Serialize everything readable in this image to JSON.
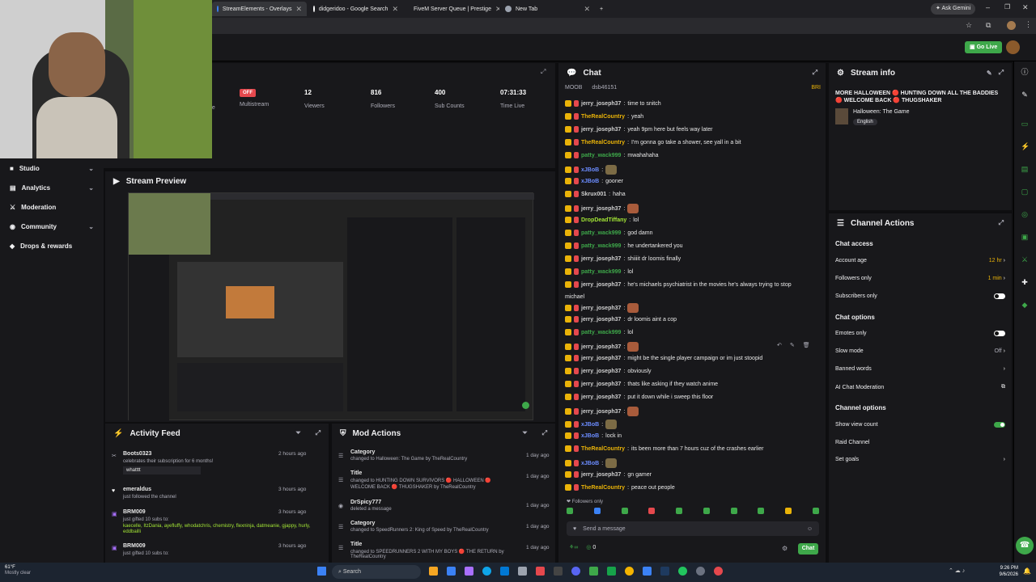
{
  "browser": {
    "tabs": [
      {
        "label": "StreamElements - Overlays",
        "color": "#3b82f6"
      },
      {
        "label": "didgeridoo - Google Search",
        "color": "#ffffff"
      },
      {
        "label": "FiveM Server Queue | Prestige",
        "color": "#ef4444"
      },
      {
        "label": "New Tab",
        "color": "#9ca3af"
      }
    ],
    "ask_gemini": "Ask Gemini"
  },
  "topnav": {
    "go_live": "Go Live"
  },
  "sidebar": {
    "items": [
      {
        "label": "Studio",
        "has_chevron": true
      },
      {
        "label": "Analytics",
        "has_chevron": true
      },
      {
        "label": "Moderation",
        "has_chevron": false
      },
      {
        "label": "Community",
        "has_chevron": true
      },
      {
        "label": "Drops & rewards",
        "has_chevron": false
      }
    ]
  },
  "stats": {
    "partial_label": "ne",
    "multistream_badge": "OFF",
    "multistream_label": "Multistream",
    "viewers_value": "12",
    "viewers_label": "Viewers",
    "followers_value": "816",
    "followers_label": "Followers",
    "subs_value": "400",
    "subs_label": "Sub Counts",
    "time_value": "07:31:33",
    "time_label": "Time Live"
  },
  "stream_preview": {
    "title": "Stream Preview"
  },
  "activity_feed": {
    "title": "Activity Feed",
    "items": [
      {
        "user": "Boots0323",
        "text": "celebrates their subscription for 6 months!",
        "time": "2 hours ago",
        "message": "whatttt"
      },
      {
        "user": "emeraldus",
        "text": "just followed the channel",
        "time": "3 hours ago"
      },
      {
        "user": "BRM009",
        "text": "just gifted 10 subs to:",
        "time": "3 hours ago",
        "list": "kaecelle, ItzDania, ayefluffy, whodatchris, chemistry, flexninja, datmeanie, gjappy, hurly, eddbailli"
      },
      {
        "user": "BRM009",
        "text": "just gifted 10 subs to:",
        "time": "3 hours ago"
      }
    ]
  },
  "mod_actions": {
    "title": "Mod Actions",
    "items": [
      {
        "type": "Category",
        "detail": "changed to Halloween: The Game by TheRealCountry",
        "time": "1 day ago"
      },
      {
        "type": "Title",
        "detail": "changed to HUNTING DOWN SURVIVORS 🔴 HALLOWEEN 🔴 WELCOME BACK 🔴 THUGSHAKER by TheRealCountry",
        "time": "1 day ago"
      },
      {
        "type": "DrSpicy777",
        "detail": "deleted a message",
        "time": "1 day ago"
      },
      {
        "type": "Category",
        "detail": "changed to SpeedRunners 2: King of Speed by TheRealCountry",
        "time": "1 day ago"
      },
      {
        "type": "Title",
        "detail": "changed to SPEEDRUNNERS 2 WITH MY BOYS 🔴 THE RETURN by TheRealCountry",
        "time": "1 day ago"
      }
    ]
  },
  "chat": {
    "title": "Chat",
    "top_users": [
      "MOOB",
      "dsb46151"
    ],
    "top_badge": "BRI",
    "lines": [
      {
        "user": "jerry_joseph37",
        "cls": "u-j",
        "msg": "time to snitch"
      },
      {
        "user": "TheRealCountry",
        "cls": "u-r",
        "msg": "yeah"
      },
      {
        "user": "jerry_joseph37",
        "cls": "u-j",
        "msg": "yeah 9pm here but feels way later"
      },
      {
        "user": "TheRealCountry",
        "cls": "u-r",
        "msg": "I'm gonna go take a shower, see yall in a bit"
      },
      {
        "user": "patty_wack999",
        "cls": "u-p",
        "msg": "mwahahaha"
      },
      {
        "user": "xJBoB",
        "cls": "u-x",
        "msg": "",
        "emote": true
      },
      {
        "user": "xJBoB",
        "cls": "u-x",
        "msg": "gooner"
      },
      {
        "user": "Skrux001",
        "cls": "u-s",
        "msg": "haha"
      },
      {
        "user": "jerry_joseph37",
        "cls": "u-j",
        "msg": "",
        "emote": true
      },
      {
        "user": "DropDeadTiffany",
        "cls": "u-d",
        "msg": "lol"
      },
      {
        "user": "patty_wack999",
        "cls": "u-p",
        "msg": "god damn"
      },
      {
        "user": "patty_wack999",
        "cls": "u-p",
        "msg": "he undertankered you"
      },
      {
        "user": "jerry_joseph37",
        "cls": "u-j",
        "msg": "shiiiit dr loomis finally"
      },
      {
        "user": "patty_wack999",
        "cls": "u-p",
        "msg": "lol"
      },
      {
        "user": "jerry_joseph37",
        "cls": "u-j",
        "msg": "he's michaels psychiatrist in the movies he's always trying to stop"
      },
      {
        "user": "",
        "cls": "u-j",
        "msg": "michael"
      },
      {
        "user": "jerry_joseph37",
        "cls": "u-j",
        "msg": "",
        "emote": true
      },
      {
        "user": "jerry_joseph37",
        "cls": "u-j",
        "msg": "dr loomis aint a cop"
      },
      {
        "user": "patty_wack999",
        "cls": "u-p",
        "msg": "lol"
      },
      {
        "user": "jerry_joseph37",
        "cls": "u-j",
        "msg": "",
        "emote": true
      },
      {
        "user": "jerry_joseph37",
        "cls": "u-j",
        "msg": "might be the single player campaign or im just stoopid"
      },
      {
        "user": "jerry_joseph37",
        "cls": "u-j",
        "msg": "obviously"
      },
      {
        "user": "jerry_joseph37",
        "cls": "u-j",
        "msg": "thats like asking if they watch anime"
      },
      {
        "user": "jerry_joseph37",
        "cls": "u-j",
        "msg": "put it down while i sweep this floor"
      },
      {
        "user": "jerry_joseph37",
        "cls": "u-j",
        "msg": "",
        "emote": true
      },
      {
        "user": "xJBoB",
        "cls": "u-x",
        "msg": "",
        "emote": true
      },
      {
        "user": "xJBoB",
        "cls": "u-x",
        "msg": "lock in"
      },
      {
        "user": "TheRealCountry",
        "cls": "u-r",
        "msg": "its been more than 7 hours cuz of the crashes earlier"
      },
      {
        "user": "xJBoB",
        "cls": "u-x",
        "msg": "",
        "emote": true
      },
      {
        "user": "jerry_joseph37",
        "cls": "u-j",
        "msg": "gn gamer"
      },
      {
        "user": "TheRealCountry",
        "cls": "u-r",
        "msg": "peace out people"
      }
    ],
    "followers_only": "Followers only",
    "placeholder": "Send a message",
    "points": "0",
    "chat_button": "Chat"
  },
  "stream_info": {
    "title": "Stream info",
    "stream_title": "MORE HALLOWEEN 🔴 HUNTING DOWN ALL THE BADDIES 🔴 WELCOME BACK 🔴 THUGSHAKER",
    "game": "Halloween: The Game",
    "language": "English"
  },
  "channel_actions": {
    "title": "Channel Actions",
    "chat_access": "Chat access",
    "account_age": "Account age",
    "account_age_value": "12 hr",
    "followers_only": "Followers only",
    "followers_only_value": "1 min",
    "subscribers_only": "Subscribers only",
    "chat_options": "Chat options",
    "emotes_only": "Emotes only",
    "slow_mode": "Slow mode",
    "slow_mode_value": "Off",
    "banned_words": "Banned words",
    "ai_moderation": "AI Chat Moderation",
    "channel_options": "Channel options",
    "show_view_count": "Show view count",
    "raid_channel": "Raid Channel",
    "set_goals": "Set goals"
  },
  "taskbar": {
    "weather_temp": "61°F",
    "weather_desc": "Mostly clear",
    "search": "Search",
    "time": "9:26 PM",
    "date": "9/6/2026"
  }
}
